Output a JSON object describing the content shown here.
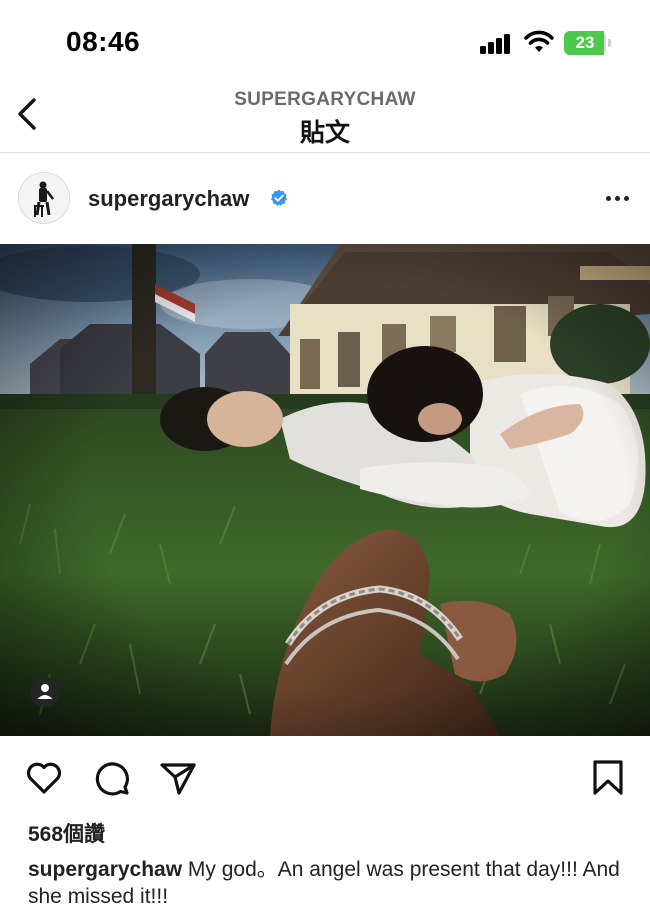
{
  "status_bar": {
    "time": "08:46",
    "battery": "23",
    "icons": [
      "signal-icon",
      "wifi-icon",
      "battery-icon"
    ]
  },
  "nav": {
    "subtitle": "SUPERGARYCHAW",
    "title": "貼文",
    "back_icon": "chevron-left-icon"
  },
  "post": {
    "username": "supergarychaw",
    "verified": true,
    "verified_color": "#3897f0",
    "more_icon": "more-horizontal-icon",
    "photo_description_icon": "user-tag-icon",
    "likes": "568個讚",
    "caption_user": "supergarychaw",
    "caption_text": " My god。An angel was present that day!!! And she missed it!!!"
  },
  "actions": {
    "like_icon": "heart-icon",
    "comment_icon": "comment-icon",
    "share_icon": "send-icon",
    "save_icon": "bookmark-icon"
  }
}
